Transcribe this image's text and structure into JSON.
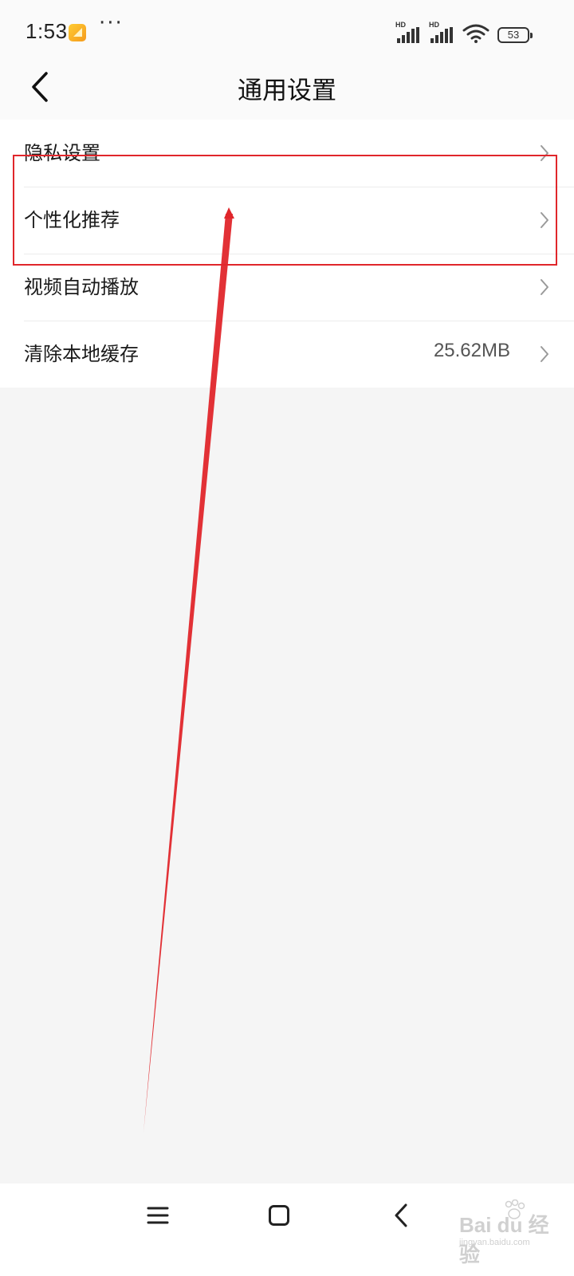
{
  "status_bar": {
    "time": "1:53",
    "more": "···",
    "sim1_label": "HD",
    "sim2_label": "HD",
    "battery_level": "53",
    "icons": [
      "gallery-notification-icon",
      "signal-icon",
      "signal-icon",
      "wifi-icon",
      "battery-icon"
    ]
  },
  "header": {
    "title": "通用设置",
    "back_icon": "chevron-left-icon"
  },
  "settings": {
    "items": [
      {
        "label": "隐私设置",
        "value": ""
      },
      {
        "label": "个性化推荐",
        "value": ""
      },
      {
        "label": "视频自动播放",
        "value": ""
      },
      {
        "label": "清除本地缓存",
        "value": "25.62MB"
      }
    ]
  },
  "annotation": {
    "highlight_color": "#e0262b",
    "highlighted_item": "个性化推荐"
  },
  "nav_bar": {
    "icons": [
      "menu-icon",
      "home-icon",
      "back-icon"
    ]
  },
  "watermark": {
    "text": "Bai du 经验",
    "sub": "jingyan.baidu.com"
  },
  "colors": {
    "background": "#f5f5f5",
    "list_background": "#ffffff",
    "accent_red": "#e0262b"
  }
}
